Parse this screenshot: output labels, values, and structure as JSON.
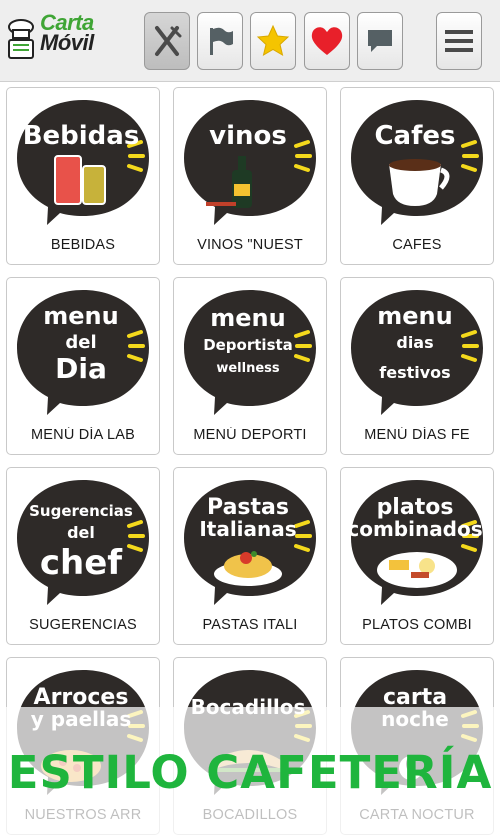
{
  "header": {
    "logo": {
      "line1": "Carta",
      "line2": "Móvil"
    },
    "buttons": [
      {
        "icon": "cutlery-icon"
      },
      {
        "icon": "flag-icon"
      },
      {
        "icon": "star-icon"
      },
      {
        "icon": "heart-icon"
      },
      {
        "icon": "chat-icon"
      }
    ],
    "menu_icon": "hamburger-menu-icon"
  },
  "tiles": [
    {
      "bubble": [
        "Bebidas"
      ],
      "label": "BEBIDAS"
    },
    {
      "bubble": [
        "vinos"
      ],
      "label": "VINOS \"NUEST"
    },
    {
      "bubble": [
        "Cafes"
      ],
      "label": "CAFES"
    },
    {
      "bubble": [
        "menu",
        "del",
        "Dia"
      ],
      "label": "MENÚ DÍA LAB"
    },
    {
      "bubble": [
        "menu",
        "Deportista",
        "wellness"
      ],
      "label": "MENÚ DEPORTI"
    },
    {
      "bubble": [
        "menu",
        "dias",
        "festivos"
      ],
      "label": "MENÚ DÍAS FE"
    },
    {
      "bubble": [
        "Sugerencias",
        "del",
        "chef"
      ],
      "label": "SUGERENCIAS"
    },
    {
      "bubble": [
        "Pastas",
        "Italianas"
      ],
      "label": "PASTAS ITALI"
    },
    {
      "bubble": [
        "platos",
        "combinados"
      ],
      "label": "PLATOS COMBI"
    },
    {
      "bubble": [
        "Arroces",
        "y paellas"
      ],
      "label": "NUESTROS ARR"
    },
    {
      "bubble": [
        "Bocadillos"
      ],
      "label": "BOCADILLOS"
    },
    {
      "bubble": [
        "carta",
        "noche"
      ],
      "label": "CARTA NOCTUR"
    }
  ],
  "banner": {
    "text": "ESTILO CAFETERÍA"
  },
  "colors": {
    "brand_green": "#3fa535",
    "banner_green": "#1fb53d",
    "bubble": "#2e2a28",
    "accent_yellow": "#f4d91c",
    "heart_red": "#e8202a"
  }
}
